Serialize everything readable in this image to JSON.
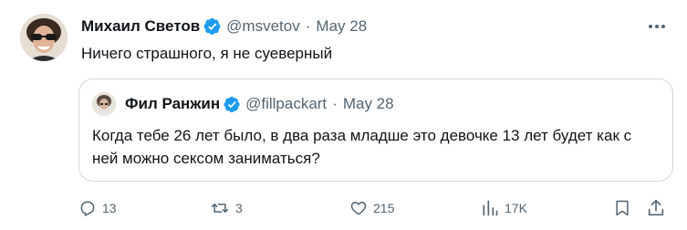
{
  "tweet": {
    "author_name": "Михаил Светов",
    "handle": "@msvetov",
    "separator": "·",
    "date": "May 28",
    "text": "Ничего страшного, я не суеверный"
  },
  "quote": {
    "author_name": "Фил Ранжин",
    "handle": "@fillpackart",
    "separator": "·",
    "date": "May 28",
    "text": "Когда тебе 26 лет было, в два раза младше это девочке 13 лет будет как с ней можно сексом заниматься?"
  },
  "actions": {
    "replies": "13",
    "retweets": "3",
    "likes": "215",
    "views": "17K"
  },
  "colors": {
    "verified": "#1d9bf0",
    "secondary_text": "#536471",
    "border": "#cfd9de"
  },
  "icons": [
    "verified-badge-icon",
    "more-icon",
    "reply-icon",
    "retweet-icon",
    "like-icon",
    "views-icon",
    "bookmark-icon",
    "share-icon"
  ]
}
